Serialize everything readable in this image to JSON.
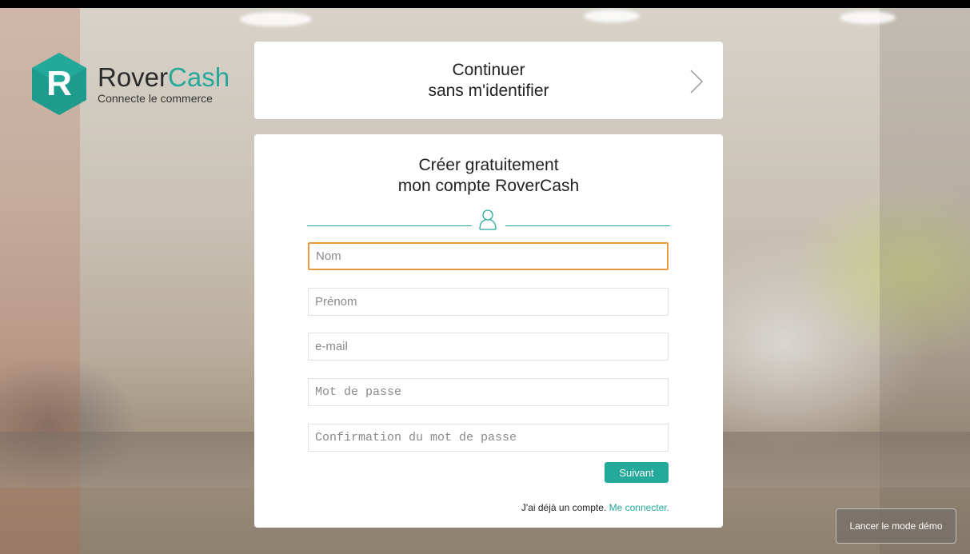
{
  "brand": {
    "logo_letter": "R",
    "name_part1": "Rover",
    "name_part2": "Cash",
    "tagline": "Connecte le commerce",
    "accent": "#24a99a"
  },
  "skip": {
    "line1": "Continuer",
    "line2": "sans m'identifier",
    "chevron_icon": "chevron-right-icon"
  },
  "signup": {
    "title_line1": "Créer gratuitement",
    "title_line2": "mon compte RoverCash",
    "divider_icon": "user-icon",
    "fields": {
      "nom": {
        "placeholder": "Nom",
        "value": ""
      },
      "prenom": {
        "placeholder": "Prénom",
        "value": ""
      },
      "email": {
        "placeholder": "e-mail",
        "value": ""
      },
      "password": {
        "placeholder": "Mot de passe",
        "value": ""
      },
      "password_confirm": {
        "placeholder": "Confirmation du mot de passe",
        "value": ""
      }
    },
    "focus_color": "#e89a3c",
    "next_label": "Suivant",
    "login_prompt": "J'ai déjà un compte.",
    "login_link": "Me connecter."
  },
  "demo": {
    "label": "Lancer le mode démo"
  }
}
